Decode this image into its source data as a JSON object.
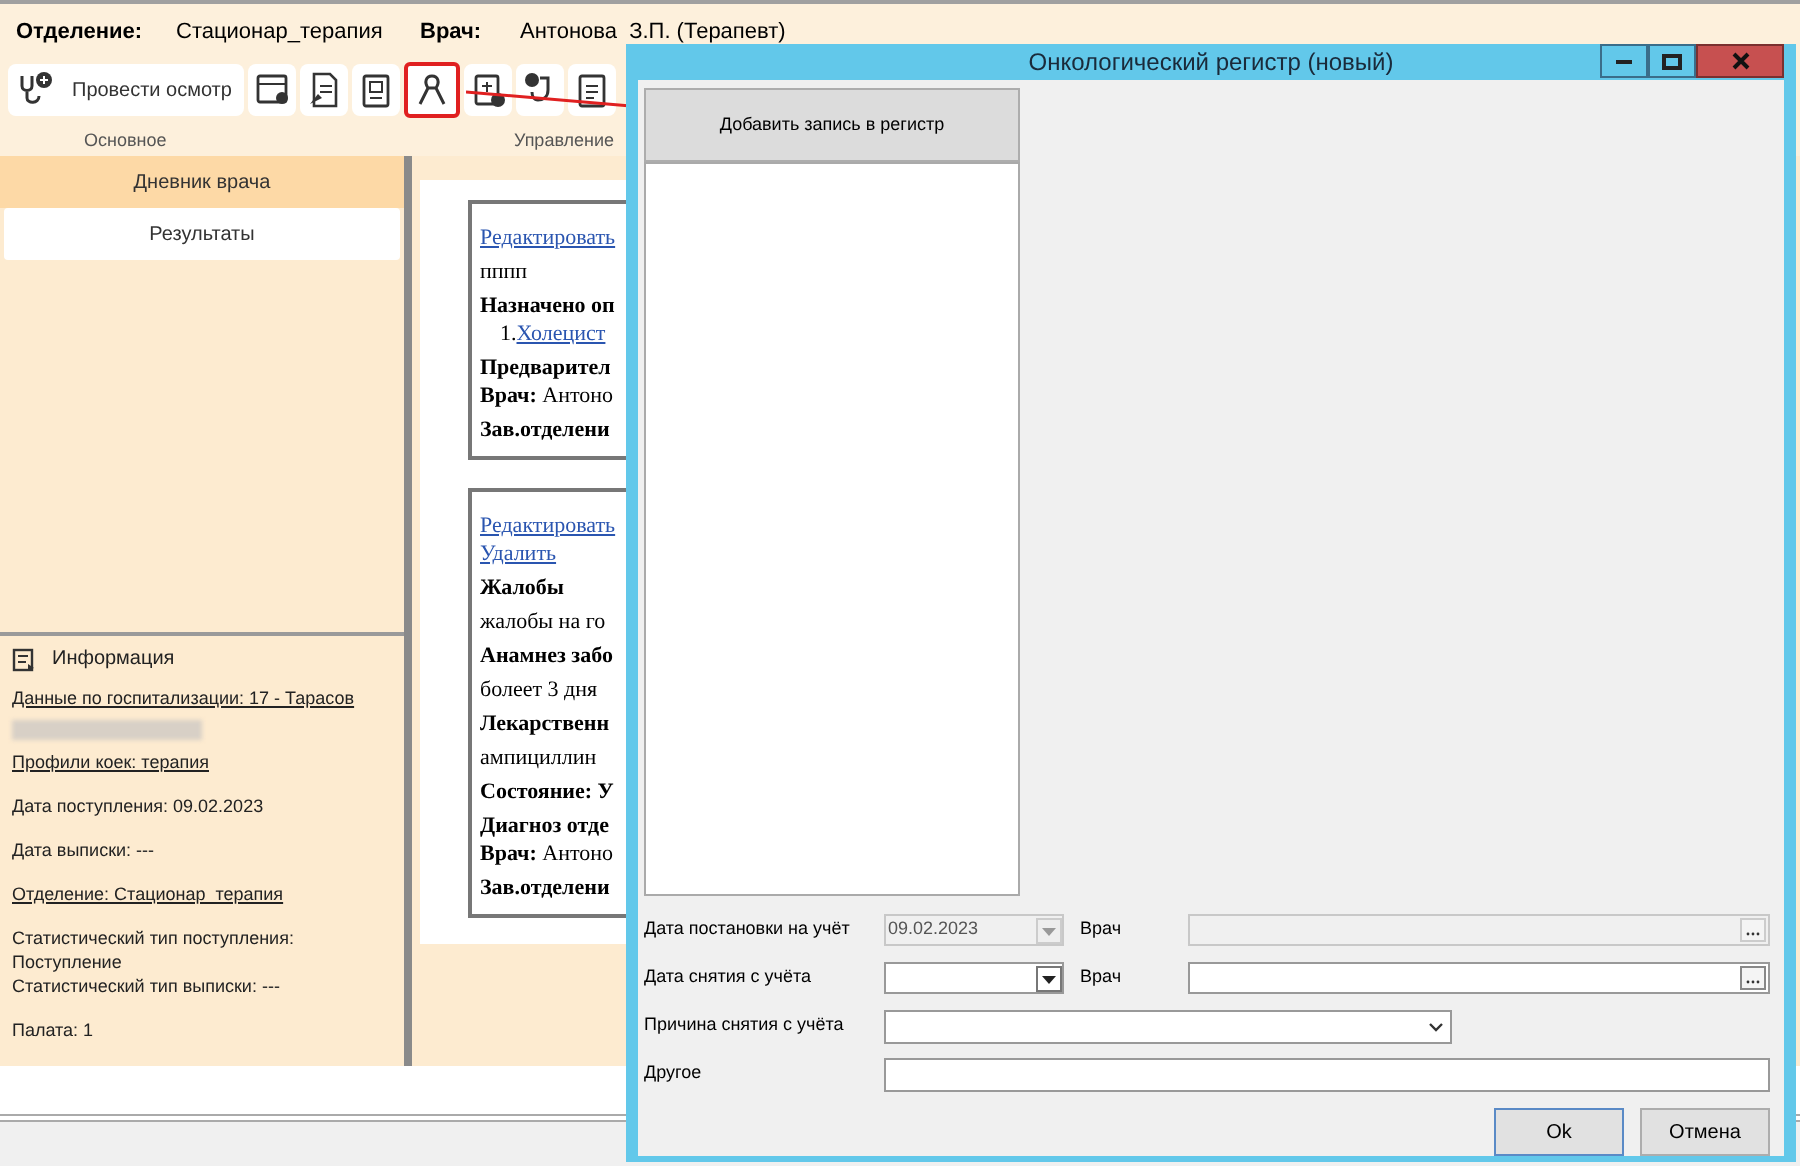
{
  "header": {
    "department_label": "Отделение:",
    "department": "Стационар_терапия",
    "doctor_label": "Врач:",
    "doctor": "Антонова  З.П. (Терапевт)"
  },
  "toolbar": {
    "main_button": "Провести осмотр",
    "icon_buttons": [
      {
        "highlighted": false
      },
      {
        "highlighted": false
      },
      {
        "highlighted": false
      },
      {
        "highlighted": true
      },
      {
        "highlighted": false
      },
      {
        "highlighted": false
      },
      {
        "highlighted": false
      }
    ],
    "groups": [
      "Основное",
      "Управление"
    ]
  },
  "sidebar_tabs": [
    {
      "label": "Дневник врача",
      "selected": true
    },
    {
      "label": "Результаты",
      "selected": false
    }
  ],
  "info": {
    "title": "Информация",
    "groups": [
      [
        {
          "kind": "link",
          "text": "Данные по госпитализации: 17 - Тарасов"
        },
        {
          "kind": "redacted"
        },
        {
          "kind": "link",
          "text": "Профили коек: терапия"
        }
      ],
      [
        {
          "kind": "plain",
          "text": "Дата поступления: 09.02.2023"
        }
      ],
      [
        {
          "kind": "plain",
          "text": "Дата выписки: ---"
        }
      ],
      [
        {
          "kind": "link",
          "text": "Отделение: Стационар_терапия"
        }
      ],
      [
        {
          "kind": "plain",
          "text": "Статистический тип поступления:"
        },
        {
          "kind": "plain",
          "text": "Поступление"
        },
        {
          "kind": "plain",
          "text": "Статистический тип выписки: ---"
        }
      ],
      [
        {
          "kind": "plain",
          "text": "Палата: 1"
        }
      ]
    ]
  },
  "cards": [
    {
      "lines": [
        {
          "kind": "link",
          "text": "Редактировать"
        },
        {
          "kind": "plain",
          "text": "пппп"
        },
        {
          "kind": "bold",
          "text": "Назначено оп"
        },
        {
          "kind": "list_link",
          "number": "1.",
          "text": "Холецист"
        },
        {
          "kind": "bold",
          "text": "Предварител"
        },
        {
          "kind": "mixed",
          "text": "**Врач:** Антоно"
        },
        {
          "kind": "bold",
          "text": "Зав.отделени"
        }
      ]
    },
    {
      "lines": [
        {
          "kind": "link",
          "text": "Редактировать"
        },
        {
          "kind": "link",
          "text": "Удалить"
        },
        {
          "kind": "bold",
          "text": "Жалобы"
        },
        {
          "kind": "plain",
          "text": "жалобы на го"
        },
        {
          "kind": "bold",
          "text": "Анамнез забо"
        },
        {
          "kind": "plain",
          "text": "болеет 3 дня"
        },
        {
          "kind": "bold",
          "text": "Лекарственн"
        },
        {
          "kind": "plain",
          "text": "ампициллин"
        },
        {
          "kind": "bold",
          "text": "Состояние: У"
        },
        {
          "kind": "bold",
          "text": "Диагноз отде"
        },
        {
          "kind": "mixed",
          "text": "**Врач:** Антоно"
        },
        {
          "kind": "bold",
          "text": "Зав.отделени"
        }
      ]
    }
  ],
  "dialog": {
    "title": "Онкологический регистр (новый)",
    "add_button": "Добавить запись в регистр",
    "date_rows": [
      {
        "label": "Дата постановки на учёт",
        "date": "09.02.2023",
        "doctor_label": "Врач",
        "disabled": true
      },
      {
        "label": "Дата снятия с учёта",
        "doctor_label": "Врач",
        "disabled": false
      }
    ],
    "reason": {
      "label": "Причина снятия с учёта"
    },
    "other": {
      "label": "Другое"
    },
    "buttons": [
      "Ok",
      "Отмена"
    ]
  }
}
